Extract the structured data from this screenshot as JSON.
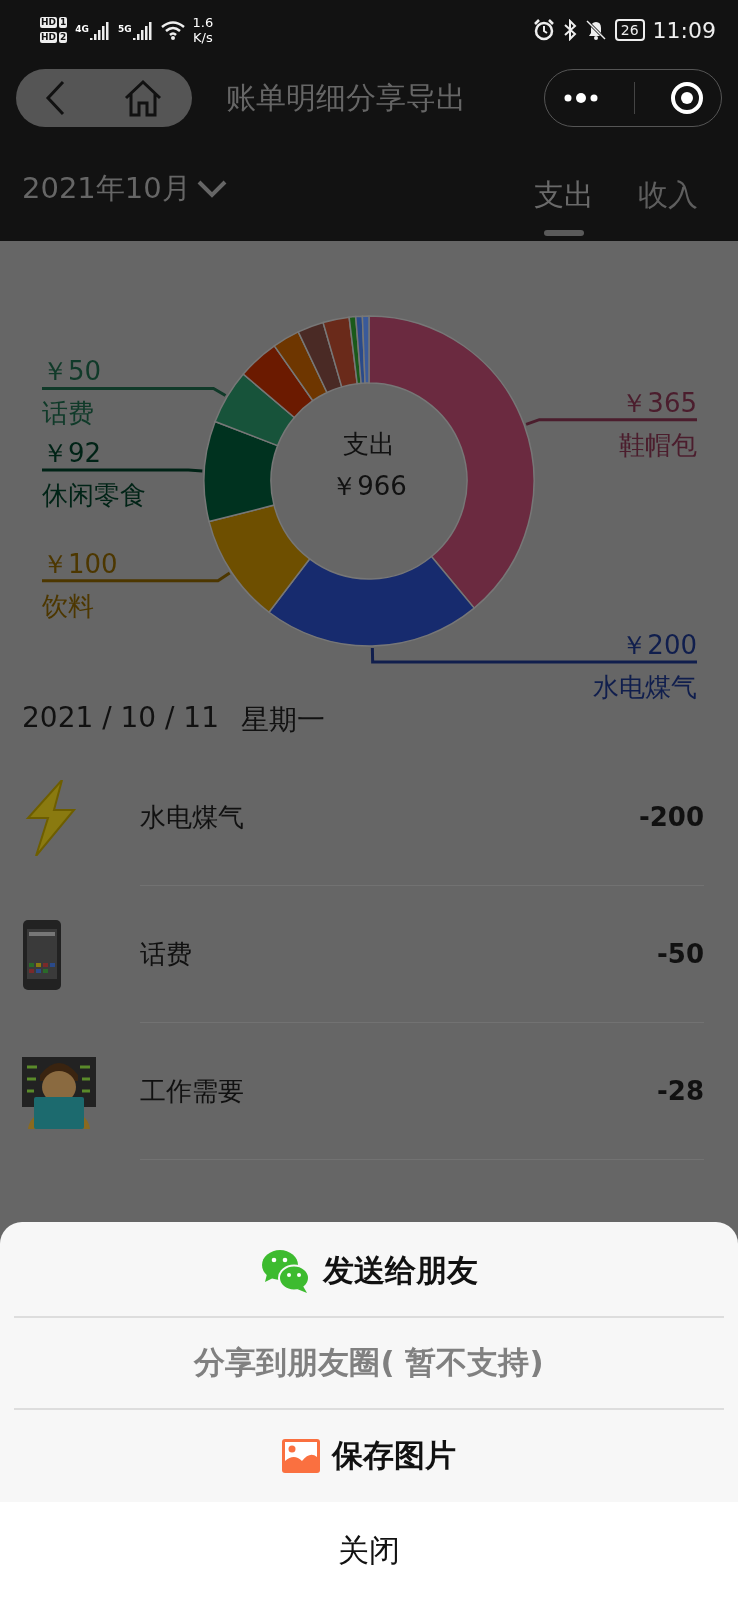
{
  "status_bar": {
    "sims": [
      {
        "badge": "HD",
        "slot": "1"
      },
      {
        "badge": "HD",
        "slot": "2"
      }
    ],
    "networks": [
      "4G",
      "5G"
    ],
    "speed": {
      "value": "1.6",
      "unit": "K/s"
    },
    "battery": "26",
    "time": "11:09"
  },
  "nav": {
    "title": "账单明细分享导出"
  },
  "month_picker": {
    "label": "2021年10月"
  },
  "tabs": [
    {
      "label": "支出",
      "selected": true
    },
    {
      "label": "收入",
      "selected": false
    }
  ],
  "chart": {
    "center_total": "￥966",
    "chart_data": {
      "type": "donut",
      "title": "支出",
      "categories": [
        "鞋帽包",
        "水电煤气",
        "饮料",
        "休闲零食",
        "话费",
        null,
        null,
        null,
        null,
        null,
        null,
        null
      ],
      "values": [
        365,
        200,
        100,
        92,
        50,
        38,
        25,
        24,
        24,
        6,
        6,
        6
      ],
      "value_labels": [
        "￥365",
        "￥200",
        "￥100",
        "￥92",
        "￥50",
        null,
        null,
        null,
        null,
        null,
        null,
        null
      ],
      "colors": [
        "#6b2a40",
        "#172b6e",
        "#6e4f00",
        "#00321f",
        "#17533a",
        "#6b1a00",
        "#6e3600",
        "#4a2a25",
        "#6a2a1a",
        "#1a5a1a",
        "#2a4a8a",
        "#3a5a9a"
      ]
    }
  },
  "day": {
    "date": "2021 / 10 / 11",
    "weekday": "星期一"
  },
  "transactions": [
    {
      "kind": "bolt",
      "name": "水电煤气",
      "amount": "-200"
    },
    {
      "kind": "phone",
      "name": "话费",
      "amount": "-50"
    },
    {
      "kind": "worker",
      "name": "工作需要",
      "amount": "-28"
    }
  ],
  "share_sheet": {
    "actions": [
      {
        "kind": "wechat",
        "label": "发送给朋友",
        "disabled": false
      },
      {
        "kind": "plain",
        "label": "分享到朋友圈( 暂不支持)",
        "disabled": true
      },
      {
        "kind": "image",
        "label": "保存图片",
        "disabled": false
      }
    ],
    "close": "关闭"
  }
}
